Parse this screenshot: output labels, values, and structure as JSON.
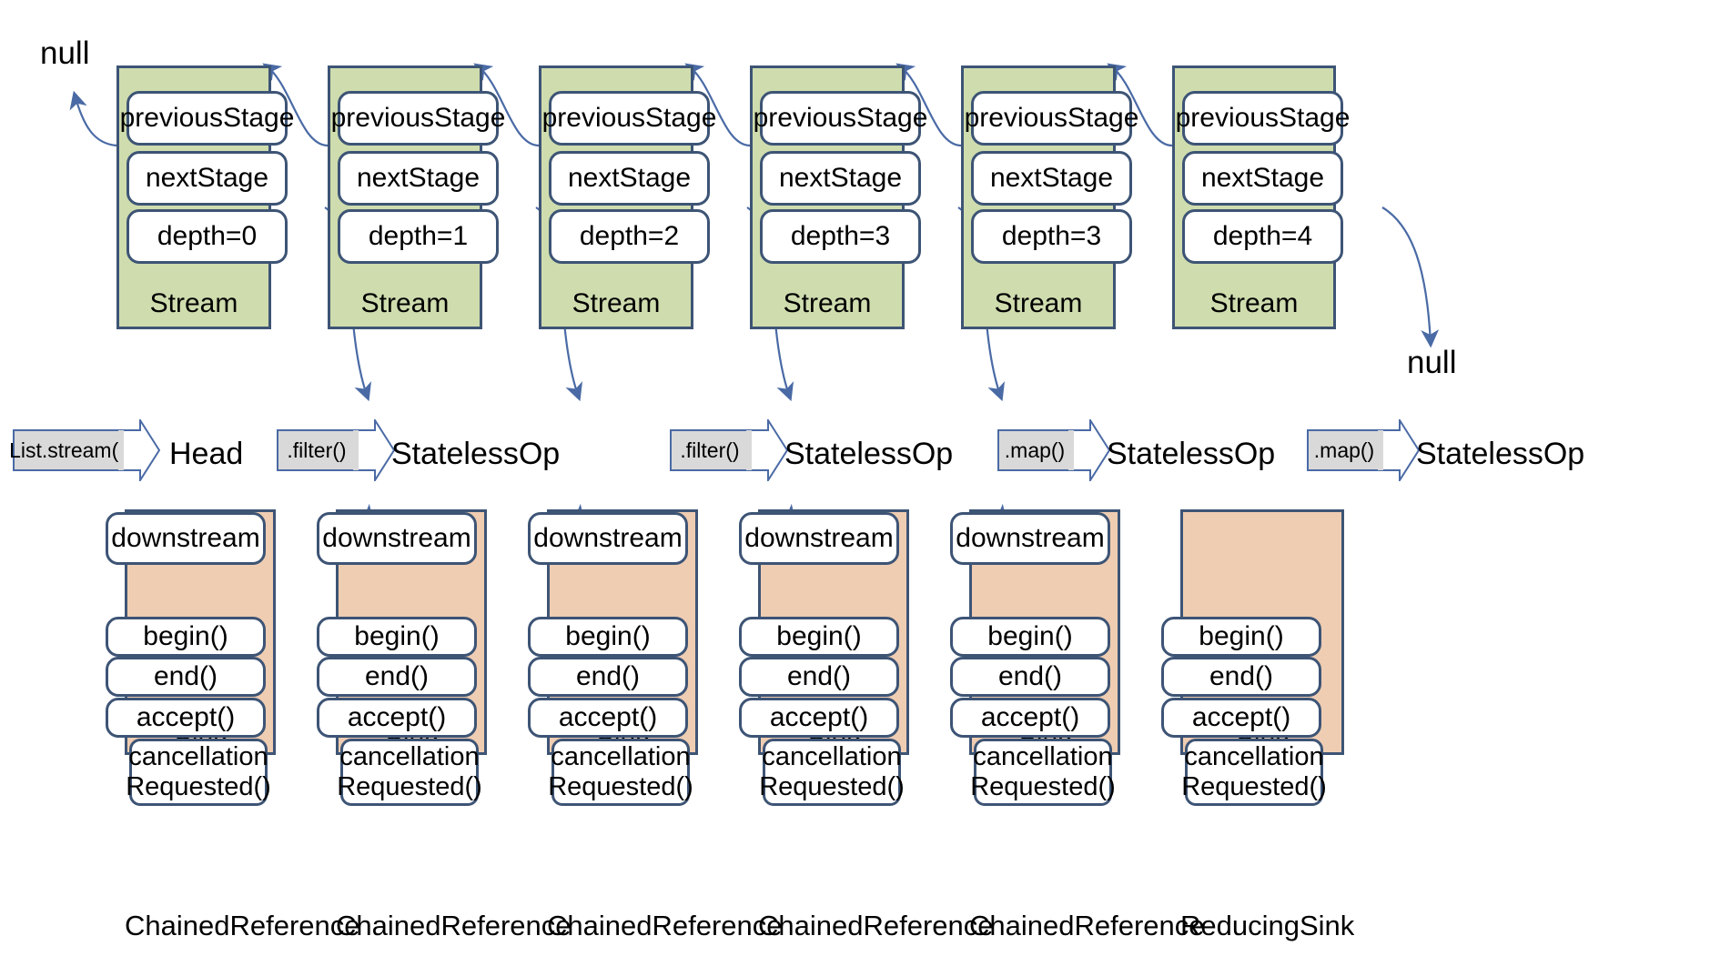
{
  "diagram": {
    "title": "Java Stream pipeline internal structure",
    "colors": {
      "stream_fill": "#cfdcae",
      "sink_fill": "#efcdb2",
      "border": "#3d5475",
      "arrow_body": "#d9d9d9",
      "arrow_border": "#4a6aa5",
      "connector": "#4a6aa5",
      "white": "#ffffff"
    },
    "labels": {
      "null_left": "null",
      "null_right": "null"
    },
    "stream_field_names": {
      "previous": "previousStage",
      "next": "nextStage",
      "depth_prefix": "depth="
    },
    "sink_field_names": {
      "downstream": "downstream",
      "begin": "begin()",
      "end": "end()",
      "accept": "accept()",
      "cancellation_line1": "cancellation",
      "cancellation_line2": "Requested()"
    },
    "stages": [
      {
        "id": "stage-0",
        "previousStage": "previousStage",
        "nextStage": "nextStage",
        "depth": "depth=0",
        "kind": "Stream",
        "op_label": "List.stream()",
        "stage_name": "Head"
      },
      {
        "id": "stage-1",
        "previousStage": "previousStage",
        "nextStage": "nextStage",
        "depth": "depth=1",
        "kind": "Stream",
        "op_label": ".filter()",
        "stage_name": "StatelessOp"
      },
      {
        "id": "stage-2",
        "previousStage": "previousStage",
        "nextStage": "nextStage",
        "depth": "depth=2",
        "kind": "Stream",
        "op_label": ".filter()",
        "stage_name": "StatelessOp"
      },
      {
        "id": "stage-3",
        "previousStage": "previousStage",
        "nextStage": "nextStage",
        "depth": "depth=3",
        "kind": "Stream",
        "op_label": ".map()",
        "stage_name": "StatelessOp"
      },
      {
        "id": "stage-4",
        "previousStage": "previousStage",
        "nextStage": "nextStage",
        "depth": "depth=4",
        "kind": "Stream",
        "op_label": ".map()",
        "stage_name": "StatelessOp"
      }
    ],
    "sinks": [
      {
        "id": "sink-0",
        "downstream": "downstream",
        "has_downstream": true,
        "begin": "begin()",
        "end": "end()",
        "accept": "accept()",
        "cancellation_line1": "cancellation",
        "cancellation_line2": "Requested()",
        "kind": "Sink",
        "caption": "ChainedReference"
      },
      {
        "id": "sink-1",
        "downstream": "downstream",
        "has_downstream": true,
        "begin": "begin()",
        "end": "end()",
        "accept": "accept()",
        "cancellation_line1": "cancellation",
        "cancellation_line2": "Requested()",
        "kind": "Sink",
        "caption": "ChainedReference"
      },
      {
        "id": "sink-2",
        "downstream": "downstream",
        "has_downstream": true,
        "begin": "begin()",
        "end": "end()",
        "accept": "accept()",
        "cancellation_line1": "cancellation",
        "cancellation_line2": "Requested()",
        "kind": "Sink",
        "caption": "ChainedReference"
      },
      {
        "id": "sink-3",
        "downstream": "downstream",
        "has_downstream": true,
        "begin": "begin()",
        "end": "end()",
        "accept": "accept()",
        "cancellation_line1": "cancellation",
        "cancellation_line2": "Requested()",
        "kind": "Sink",
        "caption": "ChainedReference"
      },
      {
        "id": "sink-4",
        "downstream": "",
        "has_downstream": false,
        "begin": "begin()",
        "end": "end()",
        "accept": "accept()",
        "cancellation_line1": "cancellation",
        "cancellation_line2": "Requested()",
        "kind": "Sink",
        "caption": "ReducingSink"
      }
    ]
  }
}
